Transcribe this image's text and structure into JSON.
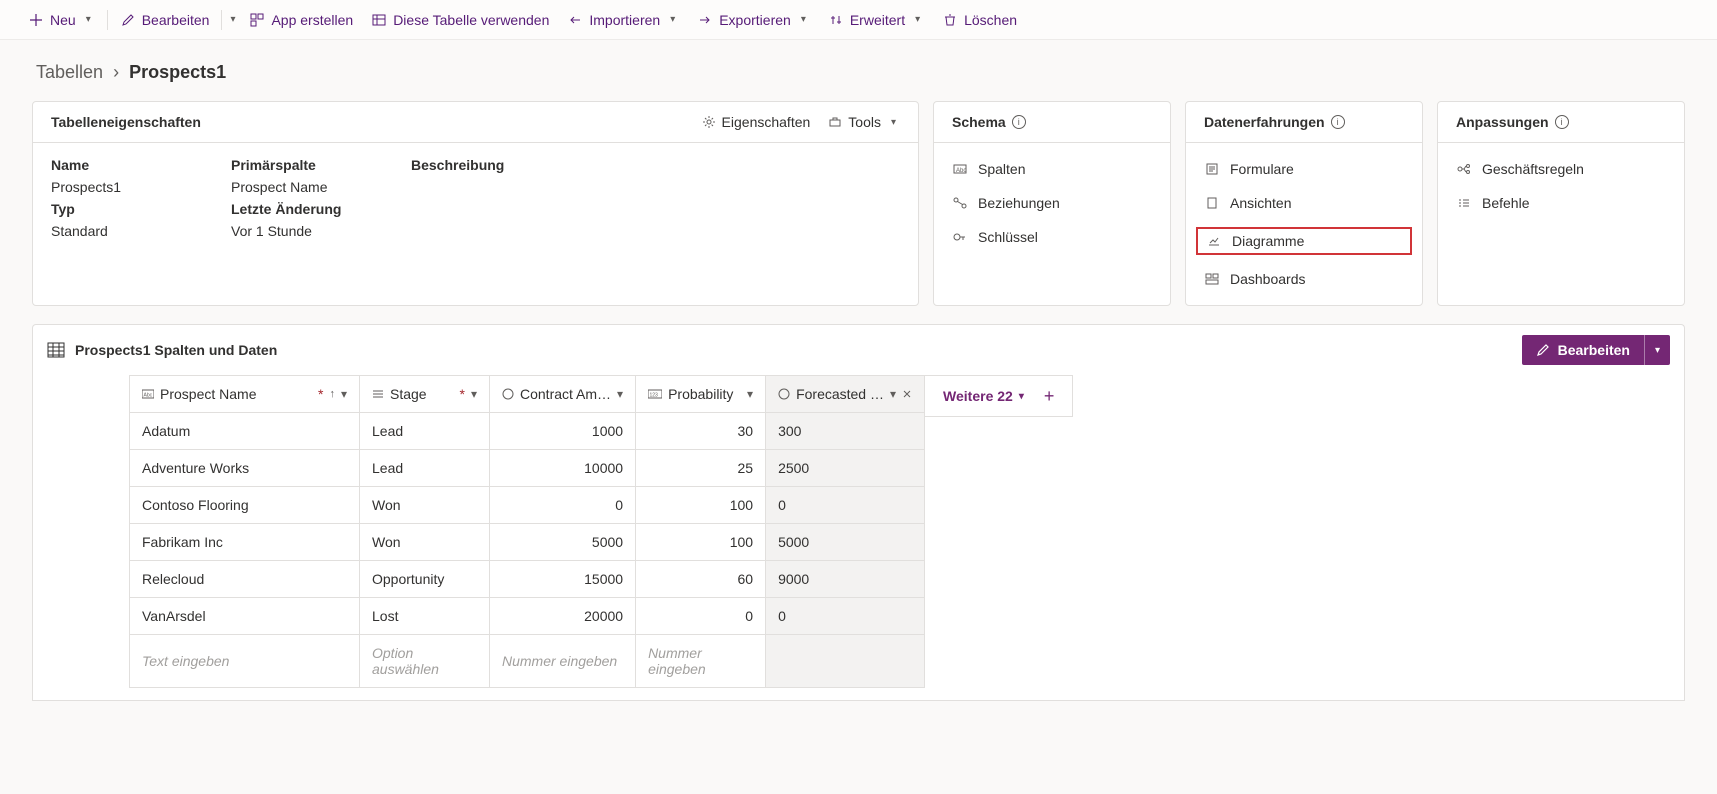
{
  "commandBar": {
    "neu": "Neu",
    "bearbeiten": "Bearbeiten",
    "appErstellen": "App erstellen",
    "tabelleVerwenden": "Diese Tabelle verwenden",
    "importieren": "Importieren",
    "exportieren": "Exportieren",
    "erweitert": "Erweitert",
    "loeschen": "Löschen"
  },
  "breadcrumb": {
    "root": "Tabellen",
    "current": "Prospects1"
  },
  "propsCard": {
    "title": "Tabelleneigenschaften",
    "actions": {
      "eigenschaften": "Eigenschaften",
      "tools": "Tools"
    },
    "labels": {
      "name": "Name",
      "primary": "Primärspalte",
      "desc": "Beschreibung",
      "type": "Typ",
      "modified": "Letzte Änderung"
    },
    "values": {
      "name": "Prospects1",
      "primary": "Prospect Name",
      "type": "Standard",
      "modified": "Vor 1 Stunde"
    }
  },
  "schemaCard": {
    "title": "Schema",
    "spalten": "Spalten",
    "beziehungen": "Beziehungen",
    "schluessel": "Schlüssel"
  },
  "dataCard": {
    "title": "Datenerfahrungen",
    "formulare": "Formulare",
    "ansichten": "Ansichten",
    "diagramme": "Diagramme",
    "dashboards": "Dashboards"
  },
  "customCard": {
    "title": "Anpassungen",
    "regeln": "Geschäftsregeln",
    "befehle": "Befehle"
  },
  "gridSection": {
    "title": "Prospects1 Spalten und Daten",
    "editLabel": "Bearbeiten",
    "moreLabel": "Weitere 22",
    "headers": {
      "prospect": "Prospect Name",
      "stage": "Stage",
      "amount": "Contract Am…",
      "prob": "Probability",
      "forecast": "Forecasted …"
    },
    "placeholder": {
      "text": "Text eingeben",
      "option": "Option auswählen",
      "number": "Nummer eingeben"
    },
    "rows": [
      {
        "name": "Adatum",
        "stage": "Lead",
        "amount": "1000",
        "prob": "30",
        "forecast": "300"
      },
      {
        "name": "Adventure Works",
        "stage": "Lead",
        "amount": "10000",
        "prob": "25",
        "forecast": "2500"
      },
      {
        "name": "Contoso Flooring",
        "stage": "Won",
        "amount": "0",
        "prob": "100",
        "forecast": "0"
      },
      {
        "name": "Fabrikam Inc",
        "stage": "Won",
        "amount": "5000",
        "prob": "100",
        "forecast": "5000"
      },
      {
        "name": "Relecloud",
        "stage": "Opportunity",
        "amount": "15000",
        "prob": "60",
        "forecast": "9000"
      },
      {
        "name": "VanArsdel",
        "stage": "Lost",
        "amount": "20000",
        "prob": "0",
        "forecast": "0"
      }
    ]
  }
}
